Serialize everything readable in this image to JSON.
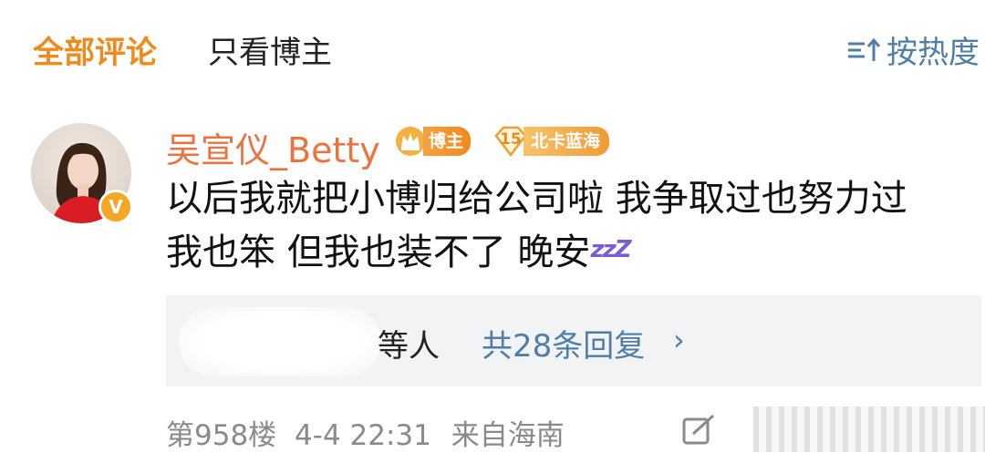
{
  "tabs": {
    "all_comments": "全部评论",
    "blogger_only": "只看博主"
  },
  "sort": {
    "label": "按热度",
    "icon": "sort-icon"
  },
  "comment": {
    "avatar_icon": "user-avatar",
    "verified_badge": "V",
    "username": "吴宣仪_Betty",
    "badge_blogger": "博主",
    "badge_level_number": "15",
    "badge_level_label": "北卡蓝海",
    "text_line1": "以后我就把小博归给公司啦 我争取过也努力过",
    "text_line2": "我也笨 但我也装不了 晚安",
    "emoji": "zzZ"
  },
  "replies": {
    "blurred_users_suffix": "等人",
    "count_label": "共28条回复",
    "arrow": "›"
  },
  "meta": {
    "floor": "第958楼",
    "datetime": "4-4 22:31",
    "location": "来自海南"
  },
  "colors": {
    "accent_orange": "#f08a1b",
    "username": "#eb7340",
    "link_blue": "#4f7fa8",
    "muted": "#8a8a8a",
    "reply_bg": "#f2f3f5"
  }
}
